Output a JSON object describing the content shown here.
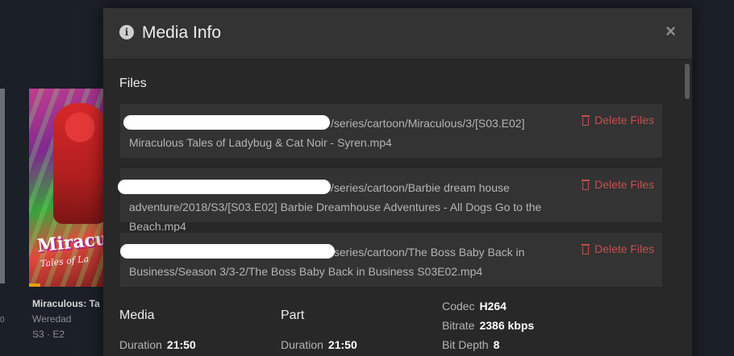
{
  "background": {
    "item_title": "Miraculous: Ta",
    "item_subtitle": "Weredad",
    "item_episode": "S3 · E2",
    "poster_logo": "Miracu",
    "poster_logo_sub": "Tales of La",
    "left_marker": "0"
  },
  "modal": {
    "title": "Media Info",
    "info_icon": "info-icon",
    "close_icon": "close-icon",
    "files_heading": "Files",
    "files": [
      {
        "path": "/series/cartoon/Miraculous/3/[S03.E02] Miraculous Tales of Ladybug & Cat Noir - Syren.mp4",
        "delete_label": "Delete Files"
      },
      {
        "path": "/series/cartoon/Barbie dream house adventure/2018/S3/[S03.E02] Barbie Dreamhouse Adventures - All Dogs Go to the Beach.mp4",
        "delete_label": "Delete Files"
      },
      {
        "path": "/series/cartoon/The Boss Baby Back in Business/Season 3/3-2/The Boss Baby Back in Business S03E02.mp4",
        "delete_label": "Delete Files"
      }
    ],
    "media": {
      "heading": "Media",
      "duration_label": "Duration",
      "duration_value": "21:50"
    },
    "part": {
      "heading": "Part",
      "duration_label": "Duration",
      "duration_value": "21:50"
    },
    "video": {
      "codec_label": "Codec",
      "codec_value": "H264",
      "bitrate_label": "Bitrate",
      "bitrate_value": "2386 kbps",
      "bitdepth_label": "Bit Depth",
      "bitdepth_value": "8"
    }
  },
  "colors": {
    "background": "#1b1f27",
    "modal": "#282828",
    "header": "#333333",
    "delete": "#c64f4f"
  }
}
